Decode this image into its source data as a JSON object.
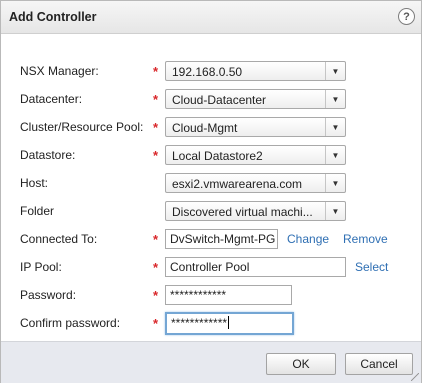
{
  "dialog": {
    "title": "Add Controller",
    "help_glyph": "?"
  },
  "form": {
    "nsx_manager": {
      "label": "NSX Manager:",
      "required": "*",
      "value": "192.168.0.50"
    },
    "datacenter": {
      "label": "Datacenter:",
      "required": "*",
      "value": "Cloud-Datacenter"
    },
    "cluster": {
      "label": "Cluster/Resource Pool:",
      "required": "*",
      "value": "Cloud-Mgmt"
    },
    "datastore": {
      "label": "Datastore:",
      "required": "*",
      "value": "Local Datastore2"
    },
    "host": {
      "label": "Host:",
      "value": "esxi2.vmwarearena.com"
    },
    "folder": {
      "label": "Folder",
      "value": "Discovered virtual machi..."
    },
    "connected_to": {
      "label": "Connected To:",
      "required": "*",
      "value": "DvSwitch-Mgmt-PG",
      "change_label": "Change",
      "remove_label": "Remove"
    },
    "ip_pool": {
      "label": "IP Pool:",
      "required": "*",
      "value": "Controller Pool",
      "select_label": "Select"
    },
    "password": {
      "label": "Password:",
      "required": "*",
      "value": "************"
    },
    "confirm": {
      "label": "Confirm password:",
      "required": "*",
      "value": "************"
    }
  },
  "buttons": {
    "ok": "OK",
    "cancel": "Cancel"
  },
  "icons": {
    "dropdown": "chevron-down-icon",
    "help": "help-icon",
    "resize": "resize-grip-icon"
  }
}
